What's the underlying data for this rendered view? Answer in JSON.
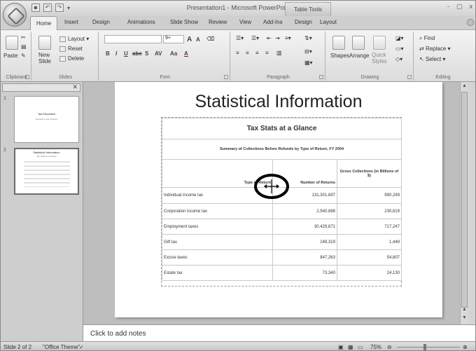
{
  "window": {
    "title": "Presentation1 - Microsoft PowerPoint",
    "contextual_tab_group": "Table Tools",
    "controls": [
      "-",
      "▢",
      "x"
    ]
  },
  "quick_access": {
    "save_icon": "save-icon",
    "undo_icon": "undo-icon",
    "redo_icon": "redo-icon",
    "customize": "▾"
  },
  "tabs": [
    "Home",
    "Insert",
    "Design",
    "Animations",
    "Slide Show",
    "Review",
    "View",
    "Add-Ins",
    "Design",
    "Layout"
  ],
  "ribbon": {
    "clipboard": {
      "label": "Clipboard",
      "paste": "Paste"
    },
    "slides": {
      "label": "Slides",
      "new_slide": "New\nSlide",
      "layout": "Layout",
      "reset": "Reset",
      "delete": "Delete"
    },
    "font": {
      "label": "Font",
      "font_size": "9+",
      "bold": "B",
      "italic": "I",
      "underline": "U",
      "strike": "abe",
      "shadow": "S",
      "spacing": "AV",
      "change_case": "Aa",
      "color": "A",
      "grow": "A",
      "shrink": "A"
    },
    "paragraph": {
      "label": "Paragraph"
    },
    "drawing": {
      "label": "Drawing",
      "shapes": "Shapes",
      "arrange": "Arrange",
      "quick_styles": "Quick\nStyles"
    },
    "editing": {
      "label": "Editing",
      "find": "Find",
      "replace": "Replace",
      "select": "Select"
    }
  },
  "thumbnails": [
    {
      "num": "1",
      "title": "Tax Education",
      "subtitle": "Questions and answers"
    },
    {
      "num": "2",
      "title": "Statistical Information",
      "subtitle": "Tax Stats at a Glance"
    }
  ],
  "slide": {
    "title": "Statistical Information",
    "table": {
      "title": "Tax Stats at a Glance",
      "summary": "Summary of Collections Before Refunds by Type of Return, FY 2004",
      "headers": [
        "Type of Return",
        "Number of Returns",
        "Gross Collections (in Billions of $)"
      ],
      "rows": [
        [
          "Individual income tax",
          "131,301,697",
          "990,249"
        ],
        [
          "Corporation income tax",
          "2,540,888",
          "230,619"
        ],
        [
          "Employment taxes",
          "30,429,671",
          "717,247"
        ],
        [
          "Gift tax",
          "249,319",
          "1,449"
        ],
        [
          "Excise taxes",
          "847,263",
          "54,807"
        ],
        [
          "Estate tax",
          "73,340",
          "24,130"
        ]
      ]
    }
  },
  "notes": {
    "placeholder": "Click to add notes"
  },
  "status": {
    "slide": "Slide 2 of 2",
    "theme": "\"Office Theme\"",
    "zoom": "75%"
  }
}
